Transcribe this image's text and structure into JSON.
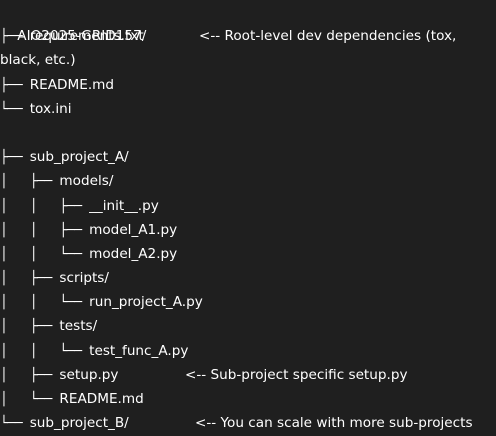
{
  "root": "AIO2025-GRID157/",
  "lines": [
    {
      "prefix": "├── ",
      "name": "requirements.txt",
      "comment": "<-- Root-level dev dependencies (tox,"
    },
    {
      "prefix": "",
      "name": "black, etc.)",
      "comment": ""
    },
    {
      "prefix": "├── ",
      "name": "README.md",
      "comment": ""
    },
    {
      "prefix": "└── ",
      "name": "tox.ini",
      "comment": ""
    },
    {
      "prefix": "",
      "name": "",
      "comment": ""
    },
    {
      "prefix": "├── ",
      "name": "sub_project_A/",
      "comment": ""
    },
    {
      "prefix": "│   ├── ",
      "name": "models/",
      "comment": ""
    },
    {
      "prefix": "│   │   ├── ",
      "name": "__init__.py",
      "comment": ""
    },
    {
      "prefix": "│   │   ├── ",
      "name": "model_A1.py",
      "comment": ""
    },
    {
      "prefix": "│   │   └── ",
      "name": "model_A2.py",
      "comment": ""
    },
    {
      "prefix": "│   ├── ",
      "name": "scripts/",
      "comment": ""
    },
    {
      "prefix": "│   │   └── ",
      "name": "run_project_A.py",
      "comment": ""
    },
    {
      "prefix": "│   ├── ",
      "name": "tests/",
      "comment": ""
    },
    {
      "prefix": "│   │   └── ",
      "name": "test_func_A.py",
      "comment": ""
    },
    {
      "prefix": "│   ├── ",
      "name": "setup.py",
      "comment": "<-- Sub-project specific setup.py"
    },
    {
      "prefix": "│   └── ",
      "name": "README.md",
      "comment": ""
    },
    {
      "prefix": "└── ",
      "name": "sub_project_B/",
      "comment": "<-- You can scale with more sub-projects"
    }
  ]
}
